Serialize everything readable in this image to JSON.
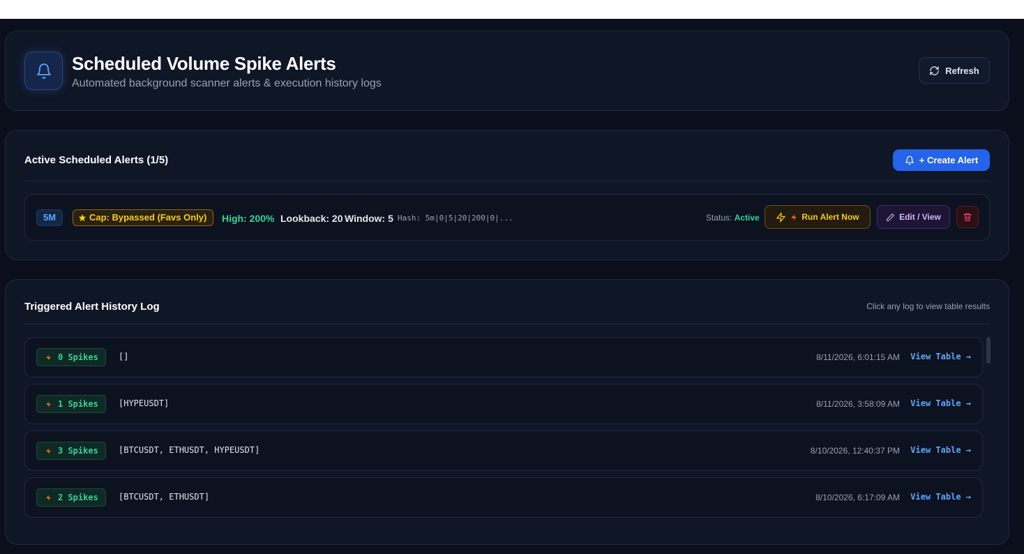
{
  "header": {
    "title": "Scheduled Volume Spike Alerts",
    "subtitle": "Automated background scanner alerts & execution history logs",
    "refresh_label": "Refresh",
    "icon": "bell-icon"
  },
  "active_alerts": {
    "title": "Active Scheduled Alerts (1/5)",
    "create_label": "+ Create Alert",
    "items": [
      {
        "timeframe": "5M",
        "cap": "Cap: Bypassed (Favs Only)",
        "high": "High: 200%",
        "lookback": "Lookback: 20",
        "window": "Window: 5",
        "hash": "Hash: 5m|0|5|20|200|0|...",
        "status_label": "Status:",
        "status_value": "Active",
        "run_label": "Run Alert Now",
        "edit_label": "Edit / View"
      }
    ]
  },
  "history": {
    "title": "Triggered Alert History Log",
    "hint": "Click any log to view table results",
    "view_label": "View Table →",
    "logs": [
      {
        "spikes": "0 Spikes",
        "symbols": "[]",
        "time": "8/11/2026, 6:01:15 AM"
      },
      {
        "spikes": "1 Spikes",
        "symbols": "[HYPEUSDT]",
        "time": "8/11/2026, 3:58:09 AM"
      },
      {
        "spikes": "3 Spikes",
        "symbols": "[BTCUSDT, ETHUSDT, HYPEUSDT]",
        "time": "8/10/2026, 12:40:37 PM"
      },
      {
        "spikes": "2 Spikes",
        "symbols": "[BTCUSDT, ETHUSDT]",
        "time": "8/10/2026, 6:17:09 AM"
      }
    ]
  },
  "colors": {
    "accent": "#2563eb",
    "success": "#34d399",
    "warning": "#facc15",
    "link": "#60a5fa",
    "danger": "#f43f5e"
  }
}
